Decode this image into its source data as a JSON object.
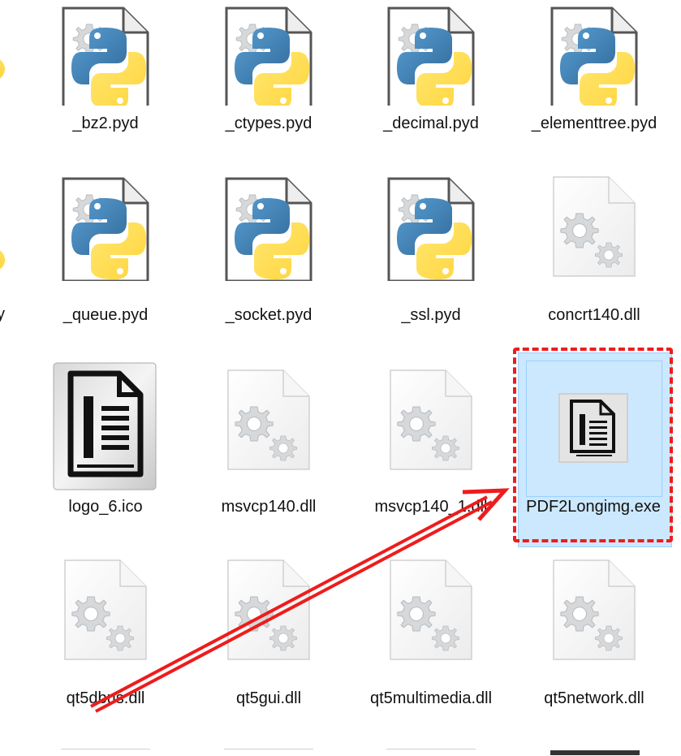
{
  "files": {
    "row1": [
      "_bz2.pyd",
      "_ctypes.pyd",
      "_decimal.pyd",
      "_elementtree.pyd"
    ],
    "row2": [
      "_queue.pyd",
      "_socket.pyd",
      "_ssl.pyd",
      "concrt140.dll"
    ],
    "row3": [
      "logo_6.ico",
      "msvcp140.dll",
      "msvcp140_1.dll",
      "PDF2Longimg.exe"
    ],
    "row4": [
      "qt5dbus.dll",
      "qt5gui.dll",
      "qt5multimedia.dll",
      "qt5network.dll"
    ]
  },
  "partial_left_label": "y",
  "selection": {
    "selected_file": "PDF2Longimg.exe",
    "highlight_color": "#cce8ff",
    "annotation_color": "#ee1c1c"
  },
  "icons": {
    "pyd": "python-file-icon",
    "dll": "dll-gear-file-icon",
    "ico": "document-logo-icon",
    "exe": "app-document-icon"
  }
}
